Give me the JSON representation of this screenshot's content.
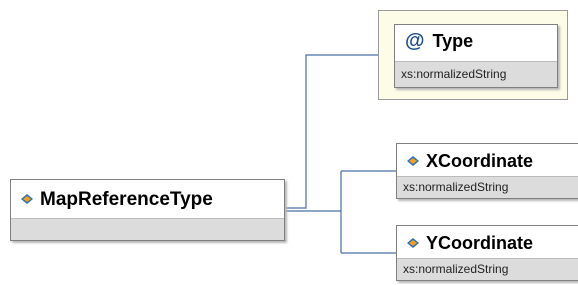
{
  "root": {
    "name": "MapReferenceType",
    "icon": "element-icon"
  },
  "attribute": {
    "name": "Type",
    "type": "xs:normalizedString",
    "icon": "attribute-at-icon",
    "symbol": "@"
  },
  "children": [
    {
      "name": "XCoordinate",
      "type": "xs:normalizedString",
      "icon": "element-icon"
    },
    {
      "name": "YCoordinate",
      "type": "xs:normalizedString",
      "icon": "element-icon"
    }
  ],
  "colors": {
    "connector": "#4a6fa5",
    "attribute_group_bg": "#fdfce6",
    "type_strip": "#dcdcdc",
    "icon_blue": "#2e6fb5",
    "icon_orange": "#f0a020"
  }
}
